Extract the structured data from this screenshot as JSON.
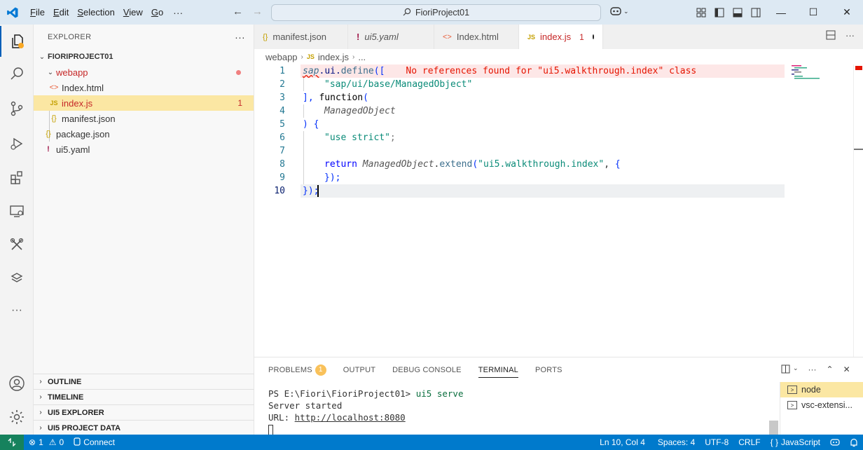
{
  "titlebar": {
    "menu": [
      "File",
      "Edit",
      "Selection",
      "View",
      "Go"
    ],
    "more": "···",
    "command_center": "FioriProject01"
  },
  "sidebar": {
    "title": "EXPLORER",
    "more": "···",
    "root": "FIORIPROJECT01",
    "items": [
      {
        "label": "webapp",
        "icon": "folder-chevron-icon",
        "color": "#c62828"
      },
      {
        "label": "Index.html",
        "icon": "html-icon",
        "color": "#e8603c"
      },
      {
        "label": "index.js",
        "icon": "js-icon",
        "badge": "1"
      },
      {
        "label": "manifest.json",
        "icon": "json-icon"
      },
      {
        "label": "package.json",
        "icon": "json-icon"
      },
      {
        "label": "ui5.yaml",
        "icon": "yaml-icon"
      }
    ],
    "sections": [
      "OUTLINE",
      "TIMELINE",
      "UI5 EXPLORER",
      "UI5 PROJECT DATA"
    ]
  },
  "tabs": [
    {
      "label": "manifest.json"
    },
    {
      "label": "ui5.yaml"
    },
    {
      "label": "Index.html"
    },
    {
      "label": "index.js",
      "badge": "1"
    }
  ],
  "breadcrumb": [
    "webapp",
    "index.js",
    "..."
  ],
  "editor": {
    "line_numbers": [
      "1",
      "2",
      "3",
      "4",
      "5",
      "6",
      "7",
      "8",
      "9",
      "10"
    ],
    "error_message": "No references found for \"ui5.walkthrough.index\" class",
    "code": {
      "l1_a": "sap",
      "l1_b": ".",
      "l1_c": "ui",
      "l1_d": ".",
      "l1_e": "define",
      "l1_f": "([",
      "l2": "\"sap/ui/base/ManagedObject\"",
      "l3_a": "],",
      "l3_b": "function",
      "l3_c": "(",
      "l4": "ManagedObject",
      "l5_a": ")",
      "l5_b": "{",
      "l6_a": "\"use strict\"",
      "l6_b": ";",
      "l8_a": "return",
      "l8_b": "ManagedObject",
      "l8_c": ".",
      "l8_d": "extend",
      "l8_e": "(",
      "l8_f": "\"ui5.walkthrough.index\"",
      "l8_g": ",",
      "l8_h": "{",
      "l9": "});",
      "l10": "});"
    }
  },
  "panel": {
    "tabs": [
      "PROBLEMS",
      "OUTPUT",
      "DEBUG CONSOLE",
      "TERMINAL",
      "PORTS"
    ],
    "problems_badge": "1",
    "terminal_lines": {
      "prompt": "PS E:\\Fiori\\FioriProject01>",
      "command": "ui5 serve",
      "line2": "Server started",
      "line3_label": "URL:",
      "line3_link": "http://localhost:8080"
    },
    "terminals": [
      "node",
      "vsc-extensi..."
    ]
  },
  "statusbar": {
    "errors": "1",
    "warnings": "0",
    "connect": "Connect",
    "position": "Ln 10, Col 4",
    "spaces": "Spaces: 4",
    "encoding": "UTF-8",
    "eol": "CRLF",
    "language": "JavaScript"
  },
  "colors": {
    "accent": "#007acc",
    "remote": "#16825d",
    "selection": "#fbe7a3",
    "error": "#e51400"
  }
}
